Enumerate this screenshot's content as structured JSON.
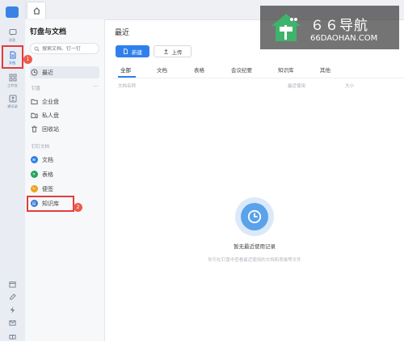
{
  "rail": {
    "items": [
      {
        "label": "消息",
        "icon": "chat-icon"
      },
      {
        "label": "文档",
        "icon": "document-icon"
      },
      {
        "label": "工作台",
        "icon": "grid-icon"
      },
      {
        "label": "通讯录",
        "icon": "contacts-icon"
      }
    ],
    "bottom_icons": [
      "calendar-icon",
      "edit-icon",
      "lightning-icon",
      "mail-icon",
      "gift-icon"
    ]
  },
  "panel": {
    "title": "钉盘与文档",
    "search_placeholder": "搜索文档、钉一钉",
    "recent": "最近",
    "section_pan": "钉盘",
    "more": "···",
    "pan_items": [
      "企业盘",
      "私人盘",
      "回收站"
    ],
    "section_docs": "钉钉文档",
    "doc_items": [
      {
        "label": "文档",
        "color": "#2f80ed"
      },
      {
        "label": "表格",
        "color": "#23a55a"
      },
      {
        "label": "便签",
        "color": "#f0a020"
      },
      {
        "label": "知识库",
        "color": "#3a7bd5"
      }
    ]
  },
  "main": {
    "title": "最近",
    "new_button": "新建",
    "upload_button": "上传",
    "tabs": [
      "全部",
      "文档",
      "表格",
      "会议纪要",
      "知识库",
      "其他"
    ],
    "columns": [
      "文档名称",
      "最近使用",
      "大小"
    ],
    "empty_title": "暂无最近使用记录",
    "empty_sub": "你可在钉盘中查看最近使用的文档和表格等文件"
  },
  "badges": [
    "1",
    "2"
  ],
  "watermark": {
    "big": "６６导航",
    "small": "66DAOHAN.COM"
  },
  "colors": {
    "accent": "#2f80ed",
    "highlight": "#e23d3d"
  }
}
